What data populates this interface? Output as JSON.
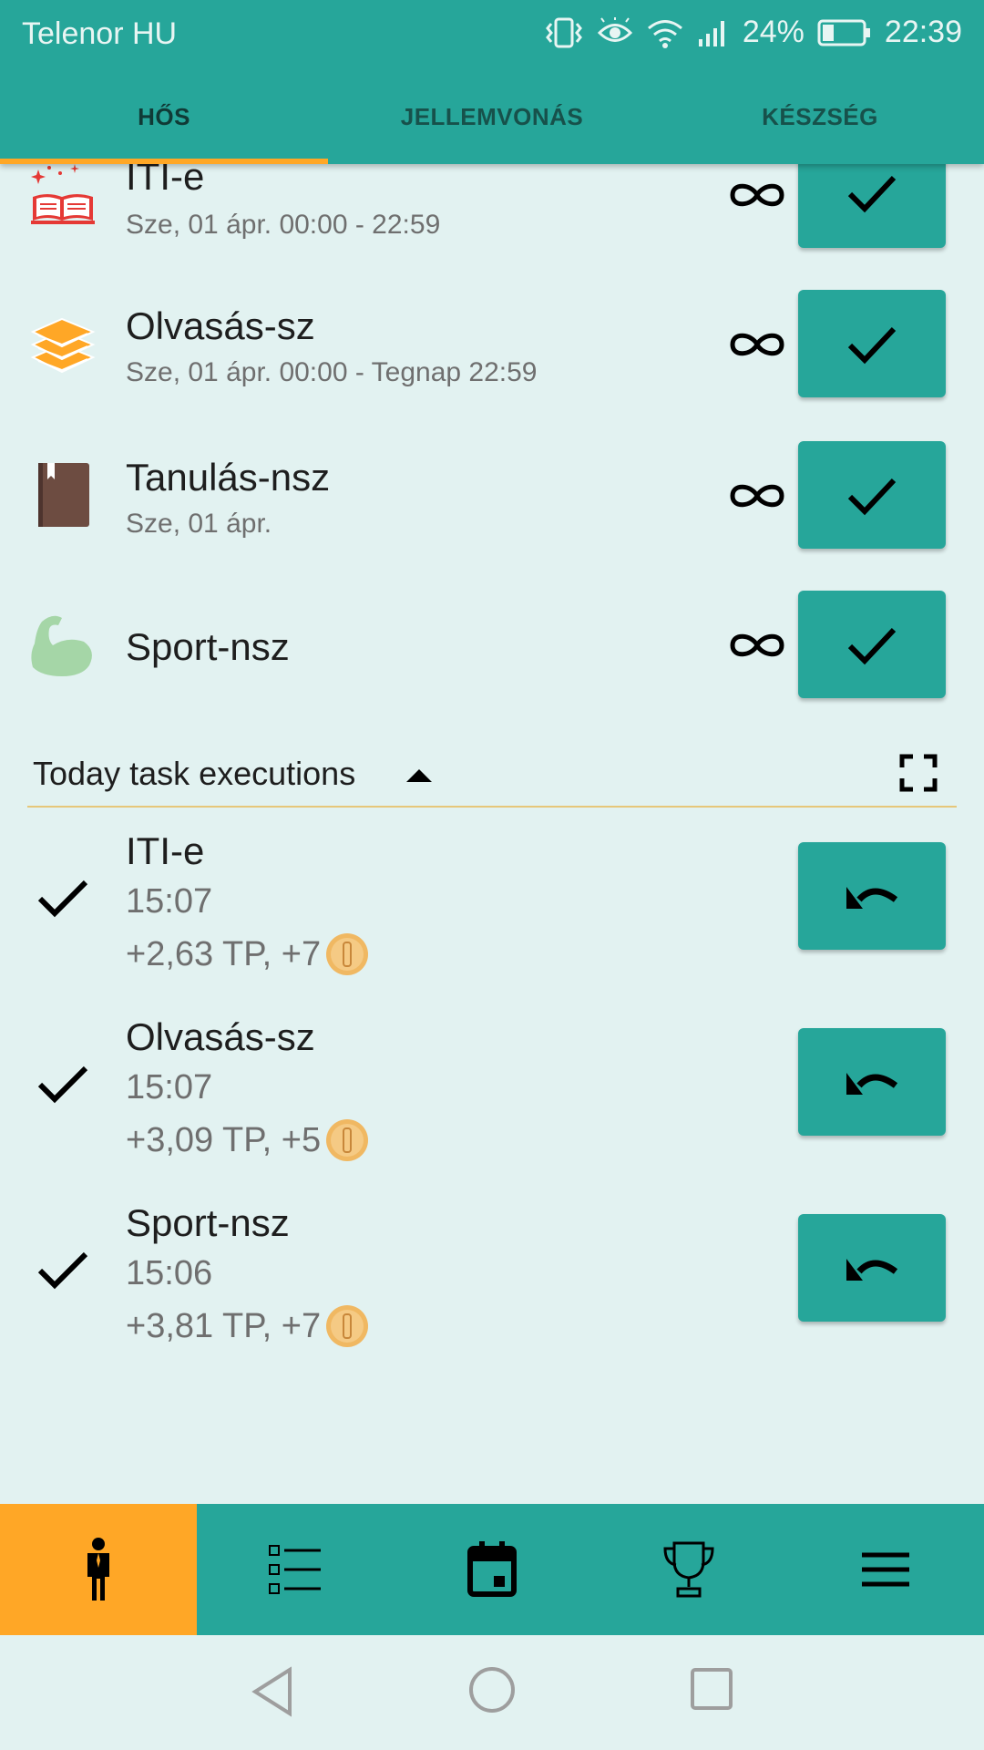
{
  "status": {
    "carrier": "Telenor HU",
    "battery": "24%",
    "time": "22:39"
  },
  "tabs": [
    {
      "label": "HŐS",
      "active": true
    },
    {
      "label": "JELLEMVONÁS",
      "active": false
    },
    {
      "label": "KÉSZSÉG",
      "active": false
    }
  ],
  "tasks": [
    {
      "name": "ITI-e",
      "schedule": "Sze, 01 ápr. 00:00 - 22:59",
      "icon": "book-sparkle-icon",
      "repeat": "∞"
    },
    {
      "name": "Olvasás-sz",
      "schedule": "Sze, 01 ápr. 00:00 - Tegnap 22:59",
      "icon": "books-stack-icon",
      "repeat": "∞"
    },
    {
      "name": "Tanulás-nsz",
      "schedule": "Sze, 01 ápr.",
      "icon": "notebook-icon",
      "repeat": "∞"
    },
    {
      "name": "Sport-nsz",
      "schedule": "",
      "icon": "flexed-arm-icon",
      "repeat": "∞"
    }
  ],
  "section": {
    "title": "Today task executions"
  },
  "executions": [
    {
      "name": "ITI-e",
      "time": "15:07",
      "reward": "+2,63 TP, +7"
    },
    {
      "name": "Olvasás-sz",
      "time": "15:07",
      "reward": "+3,09 TP, +5"
    },
    {
      "name": "Sport-nsz",
      "time": "15:06",
      "reward": "+3,81 TP, +7"
    }
  ],
  "colors": {
    "primary": "#26a69a",
    "accent": "#ffa726",
    "background": "#e2f2f1"
  }
}
